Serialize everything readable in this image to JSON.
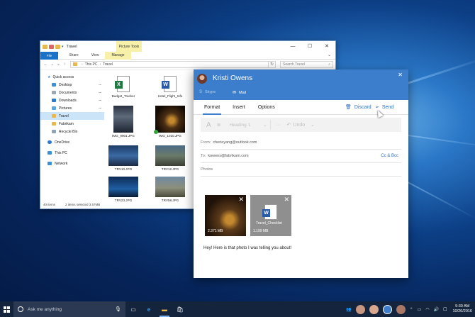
{
  "explorer": {
    "title": "Travel",
    "picture_tools": "Picture Tools",
    "window_buttons": [
      "—",
      "☐",
      "✕"
    ],
    "ribbon_tabs": [
      "File",
      "Home",
      "Share",
      "View",
      "Manage"
    ],
    "breadcrumb": [
      "This PC",
      "Travel"
    ],
    "search_placeholder": "Search Travel",
    "nav": [
      {
        "label": "Quick access",
        "icon": "star-icon"
      },
      {
        "label": "Desktop",
        "icon": "desktop-icon"
      },
      {
        "label": "Documents",
        "icon": "documents-icon"
      },
      {
        "label": "Downloads",
        "icon": "downloads-icon"
      },
      {
        "label": "Pictures",
        "icon": "pictures-icon"
      },
      {
        "label": "Travel",
        "icon": "folder-icon"
      },
      {
        "label": "Fabrikam",
        "icon": "folder-icon"
      },
      {
        "label": "Recycle Bin",
        "icon": "recycle-bin-icon"
      },
      {
        "label": "OneDrive",
        "icon": "cloud-icon"
      },
      {
        "label": "This PC",
        "icon": "computer-icon"
      },
      {
        "label": "Network",
        "icon": "network-icon"
      }
    ],
    "files": [
      {
        "name": "Budget_Tracker",
        "kind": "excel"
      },
      {
        "name": "Hotel_Flight_Info",
        "kind": "word"
      },
      {
        "name": "IMG_0901.JPG",
        "kind": "photo"
      },
      {
        "name": "IMG_1010.JPG",
        "kind": "photo"
      },
      {
        "name": "TRV10.JPG",
        "kind": "photo"
      },
      {
        "name": "TRV12.JPG",
        "kind": "photo"
      },
      {
        "name": "TRV23.JPG",
        "kind": "photo"
      },
      {
        "name": "TRV58.JPG",
        "kind": "photo"
      }
    ],
    "status": {
      "count": "40 items",
      "selected": "2 items selected  3.57MB"
    }
  },
  "mail": {
    "sender": "Kristi Owens",
    "accounts": [
      "Skype",
      "Mail"
    ],
    "tabs": [
      "Format",
      "Insert",
      "Options"
    ],
    "discard": "Discard",
    "send": "Send",
    "toolbar": {
      "heading": "Heading 1",
      "undo": "Undo"
    },
    "from_label": "From:",
    "from_value": "cherieyang@outlook.com",
    "to_label": "To:",
    "to_value": "kowens@fabrikam.com",
    "ccbcc": "Cc & Bcc",
    "subject_placeholder": "Photos",
    "attachments": [
      {
        "size": "2.371 MB"
      },
      {
        "name": "Travel_Checklist",
        "size": "1.199 MB"
      }
    ],
    "body": "Hey! Here is that photo I was telling you about!"
  },
  "taskbar": {
    "search_placeholder": "Ask me anything",
    "time": "9:30 AM",
    "date": "10/26/2016"
  },
  "colors": {
    "accent": "#3c7ecb",
    "taskbar": "#14243c",
    "link": "#2c6cc0"
  }
}
